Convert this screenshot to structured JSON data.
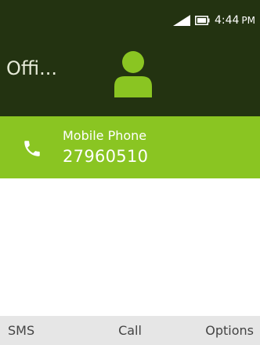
{
  "status_bar": {
    "signal_icon": "signal-icon",
    "battery_icon": "battery-icon",
    "time": "4:44",
    "ampm": "PM"
  },
  "contact": {
    "name": "Offi...",
    "avatar_icon": "person-icon"
  },
  "phone_entry": {
    "icon": "phone-icon",
    "label": "Mobile Phone",
    "number": "27960510"
  },
  "softkeys": {
    "left": "SMS",
    "center": "Call",
    "right": "Options"
  },
  "colors": {
    "header_bg": "#233311",
    "selected_row_bg": "#8ac522",
    "avatar": "#8ac522",
    "softkey_bg": "#e6e6e6"
  }
}
